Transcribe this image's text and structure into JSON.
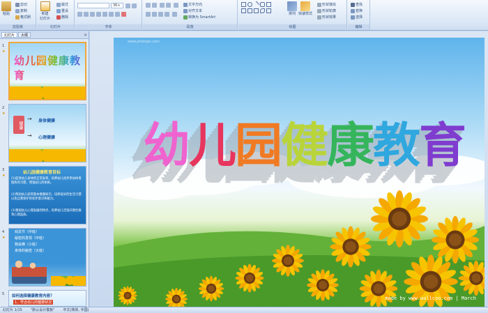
{
  "ribbon": {
    "groups": {
      "clipboard": "剪贴板",
      "slides": "幻灯片",
      "font": "字体",
      "paragraph": "段落",
      "drawing": "绘图",
      "editing": "编辑"
    },
    "clipboard": {
      "paste": "粘贴",
      "cut": "剪切",
      "copy": "复制",
      "format_painter": "格式刷"
    },
    "slides": {
      "new_slide": "新建\n幻灯片",
      "layout": "版式",
      "reset": "重设",
      "delete": "删除"
    },
    "font": {
      "size_value": "36+"
    },
    "paragraph": {
      "text_direction": "文字方向",
      "align_text": "对齐文本",
      "smartart": "转换为 SmartArt"
    },
    "drawing": {
      "arrange": "排列",
      "quick_styles": "快速样式",
      "shape_fill": "形状填充",
      "shape_outline": "形状轮廓",
      "shape_effects": "形状效果"
    },
    "editing": {
      "find": "查找",
      "replace": "替换",
      "select": "选择"
    }
  },
  "panel": {
    "tabs": {
      "slides": "幻灯片",
      "outline": "大纲"
    },
    "slides": [
      {
        "num": "1",
        "title": "幼儿园健康教育"
      },
      {
        "num": "2",
        "items": [
          "身体健康",
          "心理健康"
        ],
        "box_text": "健康"
      },
      {
        "num": "3",
        "heading": "幼儿园健康教育目标",
        "lines": [
          "(1)促进幼儿身体的正常发育，培养幼儿初步参加体育锻炼的习惯，增强幼儿的体质。",
          "(2)帮助幼儿获得基本健康知识，培养良好的生活习惯以及自我保护的初步意识和能力。",
          "(3)重视幼儿心理发展的特点，培养幼儿活泼开朗合群等心理品质。"
        ]
      },
      {
        "num": "4",
        "items": [
          "戏关节（中班）",
          "秘密的发现（中班）",
          "我会摘（小班）",
          "身体的秘密（大班）"
        ]
      },
      {
        "num": "5",
        "heading": "如何选择健康教育内容？",
        "sub": "1、符合幼儿的健康状况"
      }
    ]
  },
  "slide": {
    "title": "幼儿园健康教育",
    "title_colors": [
      "#ef63cf",
      "#e7355e",
      "#f07a23",
      "#b9d43a",
      "#35b55b",
      "#2fa7df",
      "#7f3ccf"
    ],
    "watermark": "www.photops.com",
    "credit": "made by www.wallcoo.com | March"
  },
  "status": {
    "slide_info": "幻灯片 1/15",
    "theme": "\"默认设计模板\"",
    "language": "中文(简体, 中国)"
  }
}
